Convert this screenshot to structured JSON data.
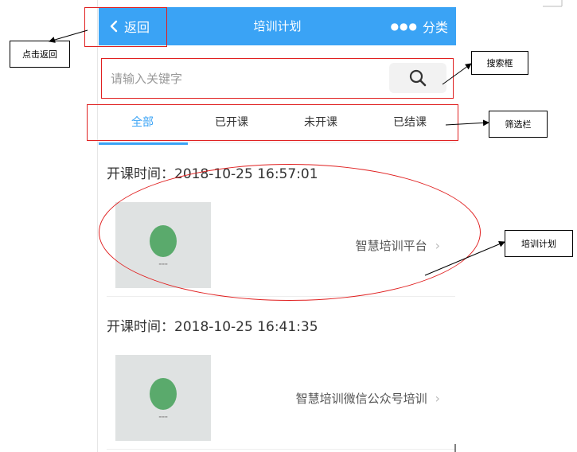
{
  "header": {
    "back_label": "返回",
    "title": "培训计划",
    "category_label": "分类",
    "background_color": "#3aa3f5"
  },
  "search": {
    "placeholder": "请输入关键字",
    "icon": "search-icon"
  },
  "tabs": [
    {
      "label": "全部",
      "active": true
    },
    {
      "label": "已开课",
      "active": false
    },
    {
      "label": "未开课",
      "active": false
    },
    {
      "label": "已结课",
      "active": false
    }
  ],
  "courses": [
    {
      "time": "开课时间：2018-10-25 16:57:01",
      "name": "智慧培训平台"
    },
    {
      "time": "开课时间：2018-10-25 16:41:35",
      "name": "智慧培训微信公众号培训"
    }
  ],
  "annotations": {
    "back": "点击返回",
    "search": "搜索框",
    "filter": "筛选栏",
    "plan": "培训计划"
  }
}
